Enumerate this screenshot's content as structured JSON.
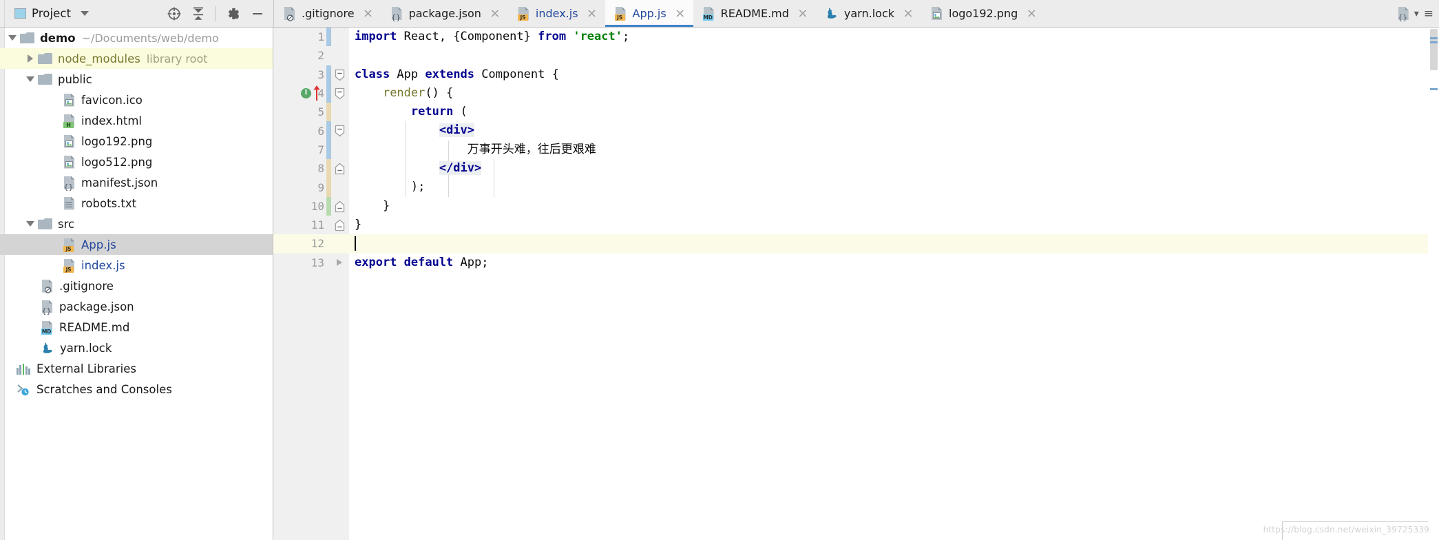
{
  "tool_window": {
    "title": "Project",
    "dropdown_caret": "▼",
    "actions": [
      {
        "name": "locate-icon",
        "tooltip": "Select Opened File"
      },
      {
        "name": "collapse-all-icon",
        "tooltip": "Collapse All"
      },
      {
        "name": "gear-icon",
        "tooltip": "Settings"
      },
      {
        "name": "minimize-icon",
        "tooltip": "Hide"
      }
    ]
  },
  "tree": [
    {
      "label": "demo",
      "secondary": "~/Documents/web/demo",
      "kind": "project-root",
      "icon": "folder-icon",
      "arrow": "down",
      "indent": 0,
      "bold": true,
      "selected": false
    },
    {
      "label": "node_modules",
      "secondary": "library root",
      "kind": "folder",
      "icon": "folder-icon",
      "arrow": "right",
      "indent": 1,
      "bold": false,
      "selected": false,
      "highlight": "library"
    },
    {
      "label": "public",
      "secondary": "",
      "kind": "folder",
      "icon": "folder-icon",
      "arrow": "down",
      "indent": 1,
      "bold": false,
      "selected": false
    },
    {
      "label": "favicon.ico",
      "secondary": "",
      "kind": "image",
      "icon": "image-file-icon",
      "arrow": "",
      "indent": 2,
      "selected": false
    },
    {
      "label": "index.html",
      "secondary": "",
      "kind": "html",
      "icon": "html-file-icon",
      "arrow": "",
      "indent": 2,
      "selected": false
    },
    {
      "label": "logo192.png",
      "secondary": "",
      "kind": "image",
      "icon": "image-file-icon",
      "arrow": "",
      "indent": 2,
      "selected": false
    },
    {
      "label": "logo512.png",
      "secondary": "",
      "kind": "image",
      "icon": "image-file-icon",
      "arrow": "",
      "indent": 2,
      "selected": false
    },
    {
      "label": "manifest.json",
      "secondary": "",
      "kind": "json",
      "icon": "json-file-icon",
      "arrow": "",
      "indent": 2,
      "selected": false
    },
    {
      "label": "robots.txt",
      "secondary": "",
      "kind": "text",
      "icon": "text-file-icon",
      "arrow": "",
      "indent": 2,
      "selected": false
    },
    {
      "label": "src",
      "secondary": "",
      "kind": "folder",
      "icon": "folder-icon",
      "arrow": "down",
      "indent": 1,
      "selected": false
    },
    {
      "label": "App.js",
      "secondary": "",
      "kind": "js",
      "icon": "js-file-icon",
      "arrow": "",
      "indent": 2,
      "selected": true
    },
    {
      "label": "index.js",
      "secondary": "",
      "kind": "js",
      "icon": "js-file-icon",
      "arrow": "",
      "indent": 2,
      "selected": false
    },
    {
      "label": ".gitignore",
      "secondary": "",
      "kind": "gitignore",
      "icon": "gitignore-file-icon",
      "arrow": "",
      "indent": 1,
      "selected": false
    },
    {
      "label": "package.json",
      "secondary": "",
      "kind": "json",
      "icon": "json-file-icon",
      "arrow": "",
      "indent": 1,
      "selected": false
    },
    {
      "label": "README.md",
      "secondary": "",
      "kind": "md",
      "icon": "markdown-file-icon",
      "arrow": "",
      "indent": 1,
      "selected": false
    },
    {
      "label": "yarn.lock",
      "secondary": "",
      "kind": "yarn",
      "icon": "yarn-file-icon",
      "arrow": "",
      "indent": 1,
      "selected": false
    },
    {
      "label": "External Libraries",
      "secondary": "",
      "kind": "external-libraries",
      "icon": "libraries-icon",
      "arrow": "",
      "indent": 0,
      "selected": false
    },
    {
      "label": "Scratches and Consoles",
      "secondary": "",
      "kind": "scratches",
      "icon": "scratches-icon",
      "arrow": "",
      "indent": 0,
      "selected": false
    }
  ],
  "tabs": [
    {
      "label": ".gitignore",
      "kind": "gitignore",
      "active": false,
      "close": "×"
    },
    {
      "label": "package.json",
      "kind": "json",
      "active": false,
      "close": "×"
    },
    {
      "label": "index.js",
      "kind": "js",
      "active": false,
      "close": "×"
    },
    {
      "label": "App.js",
      "kind": "js",
      "active": true,
      "close": "×"
    },
    {
      "label": "README.md",
      "kind": "md",
      "active": false,
      "close": "×"
    },
    {
      "label": "yarn.lock",
      "kind": "yarn",
      "active": false,
      "close": "×"
    },
    {
      "label": "logo192.png",
      "kind": "image",
      "active": false,
      "close": "×"
    }
  ],
  "tab_overflow": {
    "icon": "json-file-icon",
    "chevron": "▾",
    "list_icon": "≡"
  },
  "editor": {
    "active_line": 12,
    "line_numbers": [
      "1",
      "2",
      "3",
      "4",
      "5",
      "6",
      "7",
      "8",
      "9",
      "10",
      "11",
      "12",
      "13"
    ],
    "lines": [
      {
        "n": "1",
        "change": "blue",
        "fold": "",
        "text_plain": "import React, {Component} from 'react';"
      },
      {
        "n": "2",
        "change": "",
        "fold": "",
        "text_plain": ""
      },
      {
        "n": "3",
        "change": "blue",
        "fold": "minus",
        "text_plain": "class App extends Component {"
      },
      {
        "n": "4",
        "change": "blue",
        "fold": "minus",
        "text_plain": "    render() {",
        "gutter_icon": "implements-icon",
        "gutter_icon_label": "I",
        "gutter_marker": "red-up-arrow-icon"
      },
      {
        "n": "5",
        "change": "tan",
        "fold": "",
        "text_plain": "        return ("
      },
      {
        "n": "6",
        "change": "blue",
        "fold": "minus",
        "text_plain": "            <div>"
      },
      {
        "n": "7",
        "change": "blue",
        "fold": "",
        "text_plain": "                万事开头难，往后更艰难"
      },
      {
        "n": "8",
        "change": "tan",
        "fold": "end",
        "text_plain": "            </div>"
      },
      {
        "n": "9",
        "change": "tan",
        "fold": "",
        "text_plain": "        );"
      },
      {
        "n": "10",
        "change": "green",
        "fold": "end",
        "text_plain": "    }"
      },
      {
        "n": "11",
        "change": "",
        "fold": "end",
        "text_plain": "}"
      },
      {
        "n": "12",
        "change": "",
        "fold": "",
        "text_plain": "",
        "current": true
      },
      {
        "n": "13",
        "change": "",
        "fold": "arrow",
        "text_plain": "export default App;"
      }
    ],
    "cjk_text": "万事开头难，往后更艰难"
  },
  "colors": {
    "keyword": "#00008f",
    "string": "#007f00",
    "function": "#7a7a33",
    "js_file": "#23489c",
    "active_tab_underline": "#4083c9",
    "current_line_bg": "#fcfbe8",
    "selection_bg": "#d4d4d4",
    "library_row_bg": "#fbfbdd",
    "change_blue": "#aac9e4",
    "change_tan": "#e9d9b3",
    "change_green": "#b8dbb0",
    "gutter_bg": "#f0f0f0",
    "chrome_bg": "#ececec"
  },
  "watermark": "https://blog.csdn.net/weixin_39725339"
}
